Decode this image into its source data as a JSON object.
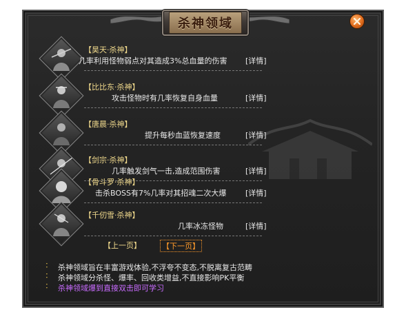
{
  "window": {
    "title": "杀神领域"
  },
  "skills": [
    {
      "name": "【昊天·杀神】",
      "desc": "几率利用怪物弱点对其造成3%总血量的伤害",
      "detail": "[详情]"
    },
    {
      "name": "【比比东·杀神】",
      "desc": "攻击怪物时有几率恢复自身血量",
      "detail": "[详情]"
    },
    {
      "name": "【唐晨·杀神】",
      "desc": "提升每秒血蓝恢复速度",
      "detail": "[详情]"
    },
    {
      "name": "【剑宗·杀神】",
      "desc": "几率触发剑气一击,造成范围伤害",
      "detail": "[详情]"
    },
    {
      "name": "【骨斗罗·杀神】",
      "desc": "击杀BOSS有7%几率对其招魂二次大爆",
      "detail": "[详情]"
    },
    {
      "name": "【千仞雪·杀神】",
      "desc": "几率冰冻怪物",
      "detail": "[详情]"
    }
  ],
  "pager": {
    "prev": "【上一页】",
    "next": "【下一页】"
  },
  "notes": [
    "杀神领域旨在丰富游戏体验,不浮夸不变态,不脱离复古范畴",
    "杀神领域分杀怪、爆率、回收类增益,不直接影响PK平衡",
    "杀神领域爆到直接双击即可学习"
  ],
  "colors": {
    "name": "#f0d98c",
    "text": "#e8e8e8",
    "next": "#ff9a2a",
    "note_highlight": "#c96cff"
  }
}
